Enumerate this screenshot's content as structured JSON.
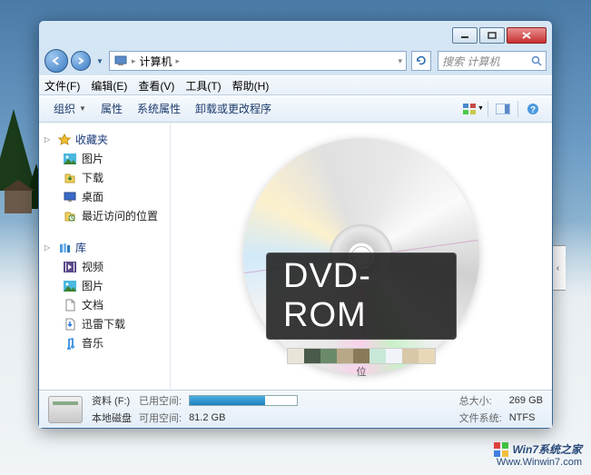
{
  "window": {
    "min_tooltip": "最小化",
    "max_tooltip": "最大化",
    "close_tooltip": "关闭"
  },
  "nav": {
    "back": "后退",
    "forward": "前进",
    "breadcrumb_root": "计算机",
    "refresh": "刷新",
    "search_placeholder": "搜索 计算机"
  },
  "menu": {
    "file": "文件(F)",
    "edit": "编辑(E)",
    "view": "查看(V)",
    "tools": "工具(T)",
    "help": "帮助(H)"
  },
  "toolbar": {
    "organize": "组织",
    "properties": "属性",
    "system_properties": "系统属性",
    "uninstall": "卸载或更改程序"
  },
  "sidebar": {
    "favorites": {
      "label": "收藏夹",
      "items": [
        "图片",
        "下载",
        "桌面",
        "最近访问的位置"
      ]
    },
    "libraries": {
      "label": "库",
      "items": [
        "视频",
        "图片",
        "文档",
        "迅雷下载",
        "音乐"
      ]
    }
  },
  "content": {
    "dvd_label": "DVD-ROM",
    "colorbar_label": "位"
  },
  "status": {
    "drive_name": "资料 (F:)",
    "drive_type": "本地磁盘",
    "used_label": "已用空间:",
    "free_label": "可用空间:",
    "free_value": "81.2 GB",
    "total_label": "总大小:",
    "total_value": "269 GB",
    "fs_label": "文件系统:",
    "fs_value": "NTFS",
    "used_percent": 70
  },
  "watermark": {
    "title": "Win7系统之家",
    "url": "Www.Winwin7.com"
  }
}
